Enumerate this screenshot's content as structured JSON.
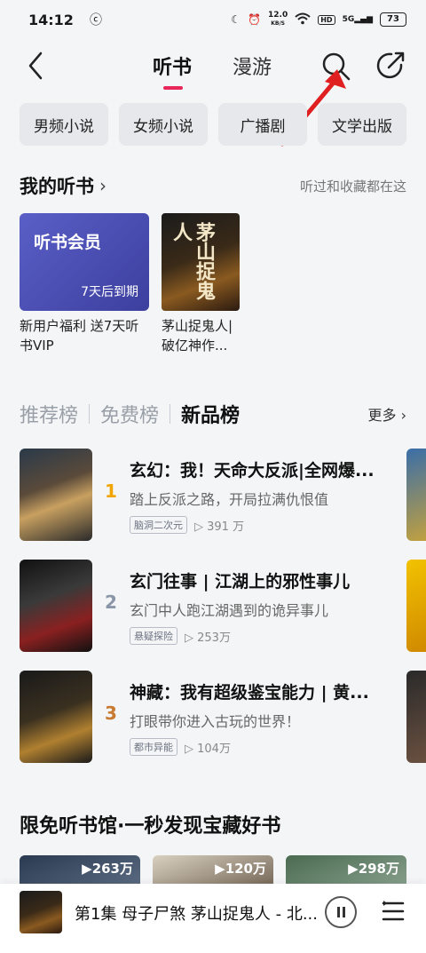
{
  "status": {
    "time": "14:12",
    "app_icon": "ꩰ",
    "net_speed_value": "12.0",
    "net_speed_unit": "KB/S",
    "hd": "HD",
    "signal": "5G",
    "battery": "73"
  },
  "nav": {
    "tab_active": "听书",
    "tab_other": "漫游"
  },
  "chips": [
    "男频小说",
    "女频小说",
    "广播剧",
    "文学出版"
  ],
  "my_books": {
    "title": "我的听书",
    "hint": "听过和收藏都在这",
    "vip_card": {
      "title": "听书会员",
      "expire": "7天后到期",
      "caption": "新用户福利 送7天听书VIP"
    },
    "book_card": {
      "cover_text": "茅山捉鬼人",
      "caption": "茅山捉鬼人| 破亿神作..."
    }
  },
  "rank": {
    "tabs": [
      "推荐榜",
      "免费榜",
      "新品榜"
    ],
    "more": "更多",
    "items": [
      {
        "num": "1",
        "title": "玄幻：我！天命大反派|全网爆...",
        "desc": "踏上反派之路，开局拉满仇恨值",
        "tag": "脑洞二次元",
        "plays": "391 万"
      },
      {
        "num": "2",
        "title": "玄门往事 | 江湖上的邪性事儿",
        "desc": "玄门中人跑江湖遇到的诡异事儿",
        "tag": "悬疑探险",
        "plays": "253万"
      },
      {
        "num": "3",
        "title": "神藏：我有超级鉴宝能力 | 黄...",
        "desc": "打眼带你进入古玩的世界！",
        "tag": "都市异能",
        "plays": "104万"
      }
    ]
  },
  "free": {
    "title": "限免听书馆·一秒发现宝藏好书",
    "counts": [
      "263万",
      "120万",
      "298万"
    ]
  },
  "player": {
    "title": "第1集 母子尸煞 茅山捉鬼人 - 北..."
  },
  "colors": {
    "accent": "#e8265a",
    "rank1": "#f0a500",
    "rank2": "#8a96a8",
    "rank3": "#c87a30"
  }
}
